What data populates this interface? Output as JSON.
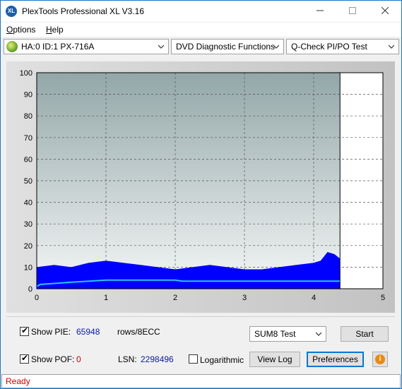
{
  "window": {
    "title": "PlexTools Professional XL V3.16",
    "icon_label": "XL"
  },
  "menu": {
    "items": [
      {
        "label": "Options",
        "underline": "O",
        "rest": "ptions"
      },
      {
        "label": "Help",
        "underline": "H",
        "rest": "elp"
      }
    ]
  },
  "toolbar": {
    "drive": "HA:0 ID:1  PX-716A",
    "function": "DVD Diagnostic Functions",
    "test": "Q-Check PI/PO Test"
  },
  "chart_data": {
    "type": "area",
    "xlim": [
      0,
      5
    ],
    "ylim": [
      0,
      100
    ],
    "x_ticks": [
      0,
      1,
      2,
      3,
      4,
      5
    ],
    "y_ticks": [
      0,
      10,
      20,
      30,
      40,
      50,
      60,
      70,
      80,
      90,
      100
    ],
    "scan_end_x": 4.38,
    "grid": true,
    "series": [
      {
        "color": "#0000ff",
        "x": [
          0.0,
          0.25,
          0.5,
          0.75,
          1.0,
          1.25,
          1.5,
          1.75,
          2.0,
          2.25,
          2.5,
          2.75,
          3.0,
          3.25,
          3.5,
          3.75,
          4.0,
          4.1,
          4.2,
          4.3,
          4.38
        ],
        "y": [
          10,
          11,
          10,
          12,
          13,
          12,
          11,
          10,
          9,
          10,
          11,
          10,
          9,
          9,
          10,
          11,
          12,
          13,
          17,
          16,
          14
        ]
      },
      {
        "color": "#29c6ff",
        "x": [
          0.0,
          0.05,
          0.5,
          1.0,
          1.5,
          2.0,
          2.1,
          2.5,
          3.0,
          3.5,
          4.0,
          4.38
        ],
        "y": [
          1,
          2,
          3,
          4,
          4,
          4,
          3.5,
          3.5,
          3.5,
          3.5,
          3.5,
          3.5
        ]
      }
    ]
  },
  "controls": {
    "show_pie_label": "Show PIE:",
    "pie_value": "65948",
    "pie_unit": "rows/8ECC",
    "show_pof_label": "Show POF:",
    "pof_value": "0",
    "lsn_label": "LSN:",
    "lsn_value": "2298496",
    "logarithmic_label": "Logarithmic",
    "test_select": "SUM8 Test",
    "start_button": "Start",
    "view_log_button": "View Log",
    "preferences_button": "Preferences",
    "show_pie_checked": true,
    "show_pof_checked": true,
    "logarithmic_checked": false
  },
  "status": {
    "text": "Ready"
  },
  "colors": {
    "status_text": "#d00000",
    "pie_value": "#0a1aa8",
    "pof_value": "#d00000",
    "accent": "#0078d7"
  }
}
